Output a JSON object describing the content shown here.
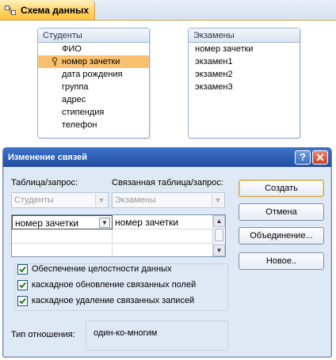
{
  "document_tab": {
    "title": "Схема данных",
    "icon": "relationships-icon"
  },
  "tables": [
    {
      "title": "Студенты",
      "fields": [
        {
          "name": "ФИО",
          "key": false,
          "selected": false
        },
        {
          "name": "номер зачетки",
          "key": true,
          "selected": true
        },
        {
          "name": "дата рождения",
          "key": false,
          "selected": false
        },
        {
          "name": "группа",
          "key": false,
          "selected": false
        },
        {
          "name": "адрес",
          "key": false,
          "selected": false
        },
        {
          "name": "стипендия",
          "key": false,
          "selected": false
        },
        {
          "name": "телефон",
          "key": false,
          "selected": false
        }
      ]
    },
    {
      "title": "Экзамены",
      "fields": [
        {
          "name": "номер зачетки"
        },
        {
          "name": "экзамен1"
        },
        {
          "name": "экзамен2"
        },
        {
          "name": "экзамен3"
        }
      ]
    }
  ],
  "dialog": {
    "title": "Изменение связей",
    "help_label": "?",
    "close_label": "✕",
    "table_label": "Таблица/запрос:",
    "related_label": "Связанная таблица/запрос:",
    "table_value": "Студенты",
    "related_value": "Экзамены",
    "grid_rows": [
      {
        "left": "номер зачетки",
        "right": "номер зачетки"
      },
      {
        "left": "",
        "right": ""
      },
      {
        "left": "",
        "right": ""
      }
    ],
    "checkboxes": [
      {
        "label": "Обеспечение целостности данных",
        "checked": true
      },
      {
        "label": "каскадное обновление связанных полей",
        "checked": true
      },
      {
        "label": "каскадное удаление связанных записей",
        "checked": true
      }
    ],
    "relation_label": "Тип отношения:",
    "relation_value": "один-ко-многим",
    "buttons": {
      "create": "Создать",
      "cancel": "Отмена",
      "join": "Объединение...",
      "new": "Новое.."
    }
  }
}
